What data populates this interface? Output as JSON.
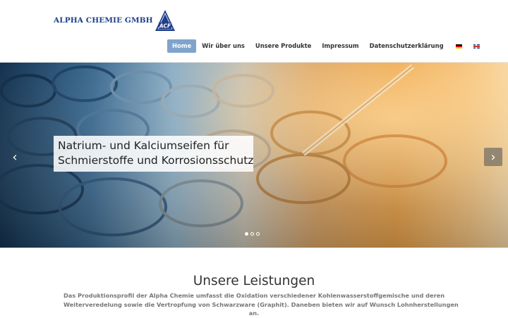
{
  "header": {
    "logo_text": "ALPHA CHEMIE GMBH",
    "logo_badge": "ACF",
    "brand_color": "#1f3f8c"
  },
  "nav": {
    "items": [
      {
        "label": "Home",
        "active": true
      },
      {
        "label": "Wir über uns",
        "active": false
      },
      {
        "label": "Unsere Produkte",
        "active": false
      },
      {
        "label": "Impressum",
        "active": false
      },
      {
        "label": "Datenschutzerklärung",
        "active": false
      }
    ],
    "active_color": "#7fa3cc",
    "languages": [
      "de-flag-icon",
      "gb-flag-icon"
    ]
  },
  "slider": {
    "caption_lines": [
      "Natrium- und Kalciumseifen für",
      "Schmierstoffe und Korrosionsschutz"
    ],
    "prev_icon": "chevron-left-icon",
    "next_icon": "chevron-right-icon",
    "slide_count": 3,
    "active_slide": 1
  },
  "section": {
    "title": "Unsere Leistungen",
    "body_lines": [
      "Das Produktionsprofil der Alpha Chemie umfasst die Oxidation verschiedener Kohlenwasserstoffgemische und deren",
      "Weiterveredelung sowie die Vertropfung von Schwarzware (Graphit). Daneben bieten wir auf Wunsch Lohnherstellungen",
      "an."
    ]
  }
}
